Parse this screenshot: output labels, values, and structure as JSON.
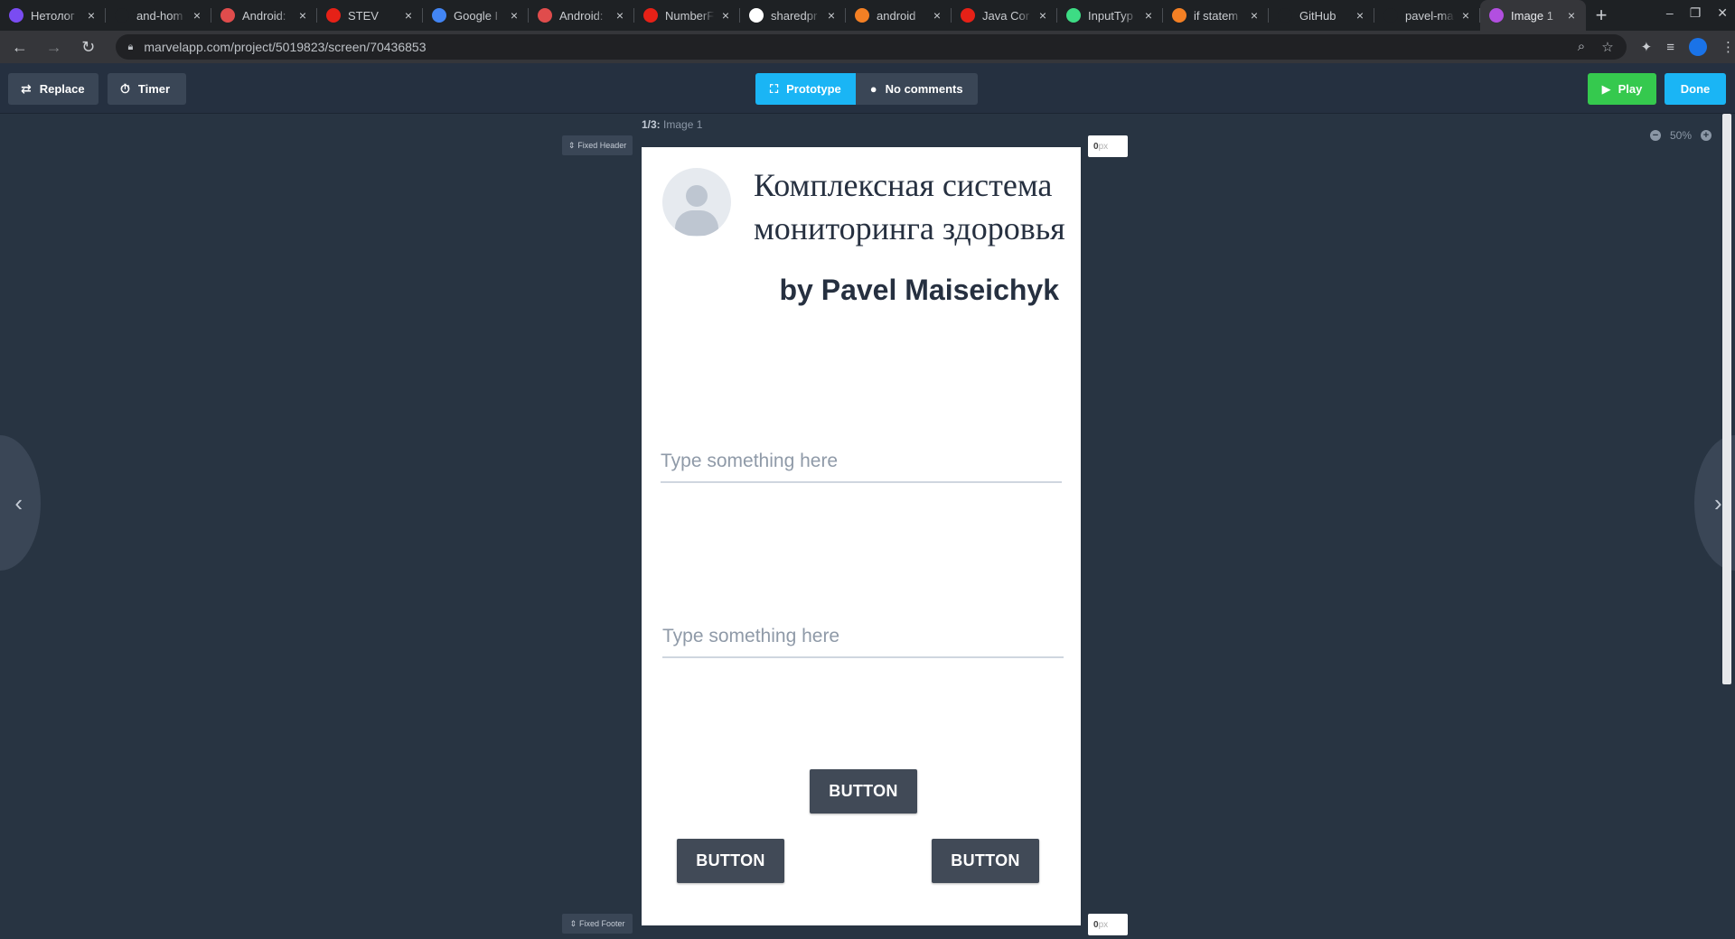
{
  "browser": {
    "tabs": [
      {
        "label": "Нетолог",
        "favicon_color": "#7a4cf2",
        "active": false
      },
      {
        "label": "and-hom",
        "favicon_color": "#1e2124",
        "active": false
      },
      {
        "label": "Android:",
        "favicon_color": "#e04c4c",
        "active": false
      },
      {
        "label": "STEV",
        "favicon_color": "#e62117",
        "active": false
      },
      {
        "label": "Google I",
        "favicon_color": "#4285f4",
        "active": false
      },
      {
        "label": "Android:",
        "favicon_color": "#e04c4c",
        "active": false
      },
      {
        "label": "NumberF",
        "favicon_color": "#e62117",
        "active": false
      },
      {
        "label": "sharedpr",
        "favicon_color": "#ffffff",
        "active": false
      },
      {
        "label": "android",
        "favicon_color": "#f48024",
        "active": false
      },
      {
        "label": "Java Cor",
        "favicon_color": "#e62117",
        "active": false
      },
      {
        "label": "InputTyp",
        "favicon_color": "#3ddc84",
        "active": false
      },
      {
        "label": "if statem",
        "favicon_color": "#f48024",
        "active": false
      },
      {
        "label": "GitHub",
        "favicon_color": "#1e2124",
        "active": false
      },
      {
        "label": "pavel-ma",
        "favicon_color": "#1e2124",
        "active": false
      },
      {
        "label": "Image 1",
        "favicon_color": "#b24fe0",
        "active": true
      }
    ],
    "url": "marvelapp.com/project/5019823/screen/70436853"
  },
  "toolbar": {
    "replace_label": "Replace",
    "timer_label": "Timer",
    "prototype_label": "Prototype",
    "comments_label": "No comments",
    "play_label": "Play",
    "done_label": "Done"
  },
  "canvas": {
    "screen_index": "1/3:",
    "screen_name": "Image 1",
    "fixed_header_label": "Fixed Header",
    "fixed_footer_label": "Fixed Footer",
    "header_px_value": "0",
    "footer_px_value": "0",
    "px_unit": "px",
    "zoom_level": "50%"
  },
  "prototype": {
    "heading": "Комплексная система мониторинга здоровья",
    "byline": "by Pavel Maiseichyk",
    "field1_placeholder": "Type something here",
    "field2_placeholder": "Type something here",
    "button_center": "BUTTON",
    "button_left": "BUTTON",
    "button_right": "BUTTON"
  }
}
